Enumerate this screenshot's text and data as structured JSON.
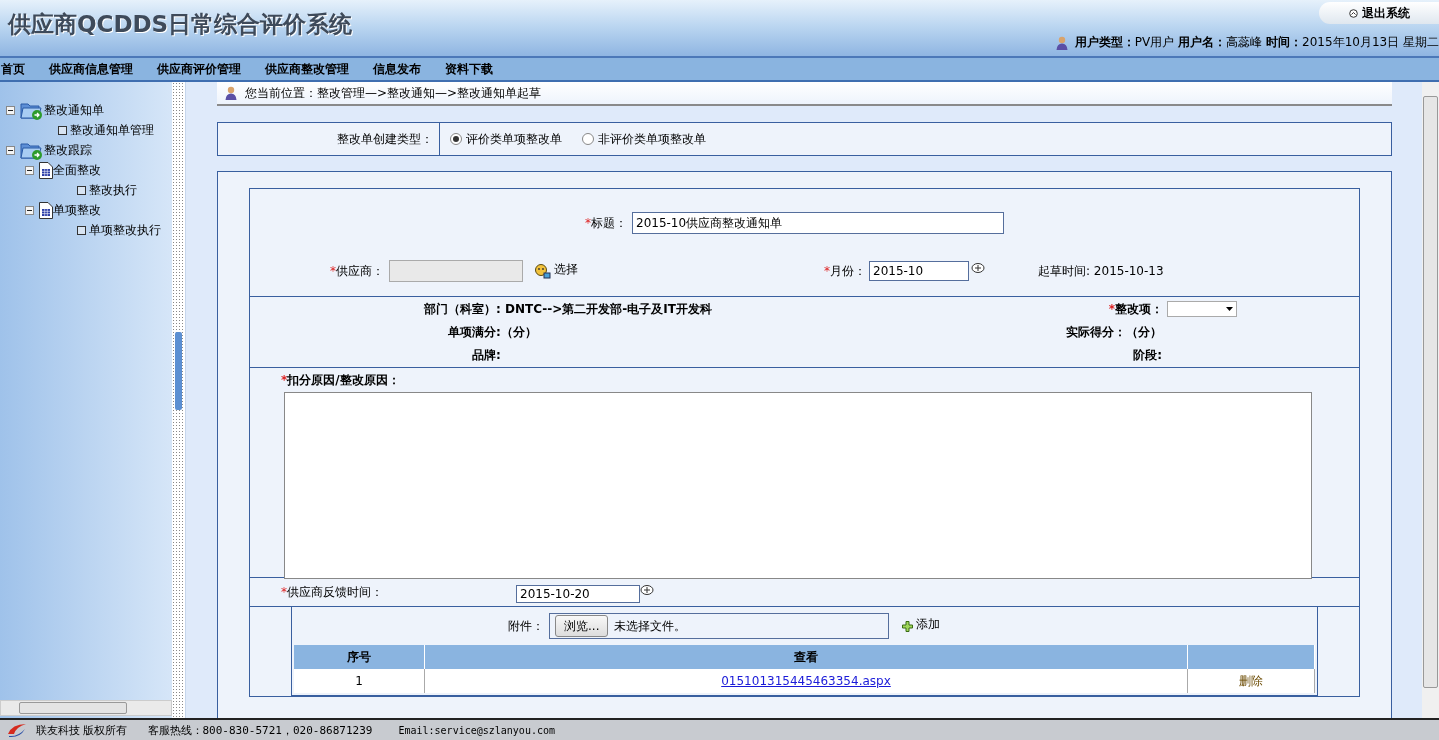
{
  "header": {
    "title": "供应商QCDDS日常综合评价系统",
    "logout": "退出系统",
    "user_info": [
      {
        "label": "用户类型：",
        "value": "PV用户"
      },
      {
        "label": "用户名：",
        "value": "高蕊峰"
      },
      {
        "label": "时间：",
        "value": "2015年10月13日 星期二"
      }
    ]
  },
  "nav": [
    "首页",
    "供应商信息管理",
    "供应商评价管理",
    "供应商整改管理",
    "信息发布",
    "资料下载"
  ],
  "tree": [
    {
      "label": "整改通知单",
      "kind": "folder",
      "expanded": true,
      "children": [
        {
          "label": "整改通知单管理",
          "kind": "leaf"
        }
      ]
    },
    {
      "label": "整改跟踪",
      "kind": "folder",
      "expanded": true,
      "children": [
        {
          "label": "全面整改",
          "kind": "doc",
          "expanded": true,
          "children": [
            {
              "label": "整改执行",
              "kind": "leaf"
            }
          ]
        },
        {
          "label": "单项整改",
          "kind": "doc",
          "expanded": true,
          "children": [
            {
              "label": "单项整改执行",
              "kind": "leaf"
            }
          ]
        }
      ]
    }
  ],
  "breadcrumb": "您当前位置：整改管理—>整改通知—>整改通知单起草",
  "create_type": {
    "label": "整改单创建类型：",
    "options": [
      {
        "label": "评价类单项整改单",
        "selected": true
      },
      {
        "label": "非评价类单项整改单",
        "selected": false
      }
    ]
  },
  "form": {
    "title_label": {
      "mark": "*",
      "text": "标题："
    },
    "title_value": "2015-10供应商整改通知单",
    "supplier_label": {
      "mark": "*",
      "text": "供应商："
    },
    "select_link": "选择",
    "month_label": {
      "mark": "*",
      "text": "月份："
    },
    "month_value": "2015-10",
    "draft_time": "起草时间: 2015-10-13",
    "dept": "部门（科室）: DNTC-->第二开发部-电子及IT开发科",
    "full_score": "单项满分:（分）",
    "brand": "品牌:",
    "item_label": {
      "mark": "*",
      "text": "整改项："
    },
    "actual_score": "实际得分：（分）",
    "stage": "阶段:",
    "reason_label": {
      "mark": "*",
      "text": "扣分原因/整改原因："
    },
    "feedback_label": {
      "mark": "*",
      "text": "供应商反馈时间："
    },
    "feedback_value": "2015-10-20"
  },
  "attachment": {
    "label": "附件：",
    "browse": "浏览...",
    "no_file": "未选择文件。",
    "add": "添加",
    "columns": [
      "序号",
      "查看"
    ],
    "rows": [
      {
        "index": "1",
        "file": "015101315445463354.aspx",
        "action": "删除"
      }
    ]
  },
  "footer": {
    "company": "联友科技 版权所有",
    "hotline": "客服热线：800-830-5721，020-86871239",
    "email": "Email:service@szlanyou.com"
  }
}
